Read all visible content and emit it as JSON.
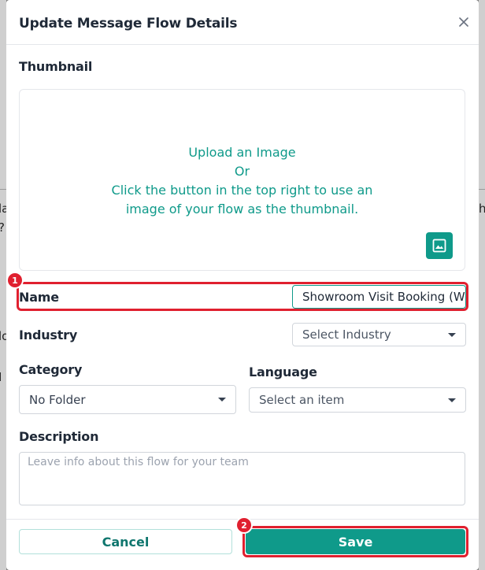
{
  "modal": {
    "title": "Update Message Flow Details"
  },
  "thumbnail": {
    "label": "Thumbnail",
    "upload_line1": "Upload an Image",
    "upload_line2": "Or",
    "upload_line3": "Click the button in the top right to use an",
    "upload_line4": "image of your flow as the thumbnail."
  },
  "name": {
    "label": "Name",
    "value": "Showroom Visit Booking (W"
  },
  "industry": {
    "label": "Industry",
    "placeholder": "Select Industry"
  },
  "category": {
    "label": "Category",
    "value": "No Folder"
  },
  "language": {
    "label": "Language",
    "placeholder": "Select an item"
  },
  "description": {
    "label": "Description",
    "placeholder": "Leave info about this flow for your team"
  },
  "footer": {
    "cancel_label": "Cancel",
    "save_label": "Save"
  },
  "annotations": {
    "badge_1": "1",
    "badge_2": "2"
  },
  "background": {
    "hint_1": "la",
    "hint_2": "?",
    "hint_3": "h",
    "hint_4": "lo",
    "hint_5": "I"
  },
  "colors": {
    "accent": "#0f9a8a",
    "highlight": "#e0202f"
  },
  "icons": {
    "close": "close-icon",
    "thumbnail_button": "image-icon",
    "dropdown": "caret-down-icon"
  }
}
